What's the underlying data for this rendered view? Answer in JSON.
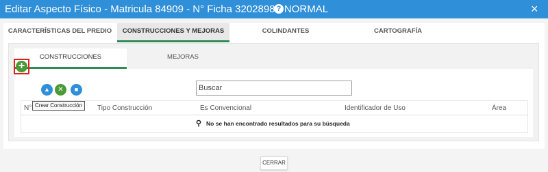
{
  "window": {
    "title": "Editar Aspecto Físico - Matricula 84909 - N° Ficha 3202898 - NORMAL",
    "help_icon": "help-icon",
    "close_glyph": "×"
  },
  "tabs": [
    {
      "label": "CARACTERÍSTICAS DEL PREDIO",
      "active": false
    },
    {
      "label": "CONSTRUCCIONES Y MEJORAS",
      "active": true
    },
    {
      "label": "COLINDANTES",
      "active": false
    },
    {
      "label": "CARTOGRAFÍA",
      "active": false
    }
  ],
  "subtabs": [
    {
      "label": "CONSTRUCCIONES",
      "active": true
    },
    {
      "label": "MEJORAS",
      "active": false
    }
  ],
  "toolbar": {
    "add_glyph": "+",
    "tooltip": "Crear Construcción",
    "icons": [
      "plus-icon",
      "image-icon",
      "tools-icon",
      "box-icon"
    ]
  },
  "search": {
    "placeholder": "Buscar"
  },
  "table": {
    "columns": [
      "N°",
      "Tipo Construcción",
      "Es Convencional",
      "Identificador de Uso",
      "Área"
    ],
    "empty_message": "No se han encontrado resultados para su búsqueda"
  },
  "footer": {
    "close_label": "CERRAR"
  },
  "colors": {
    "header_blue": "#2f8fd8",
    "accent_green": "#2e8b57",
    "highlight_red": "#e02020"
  }
}
